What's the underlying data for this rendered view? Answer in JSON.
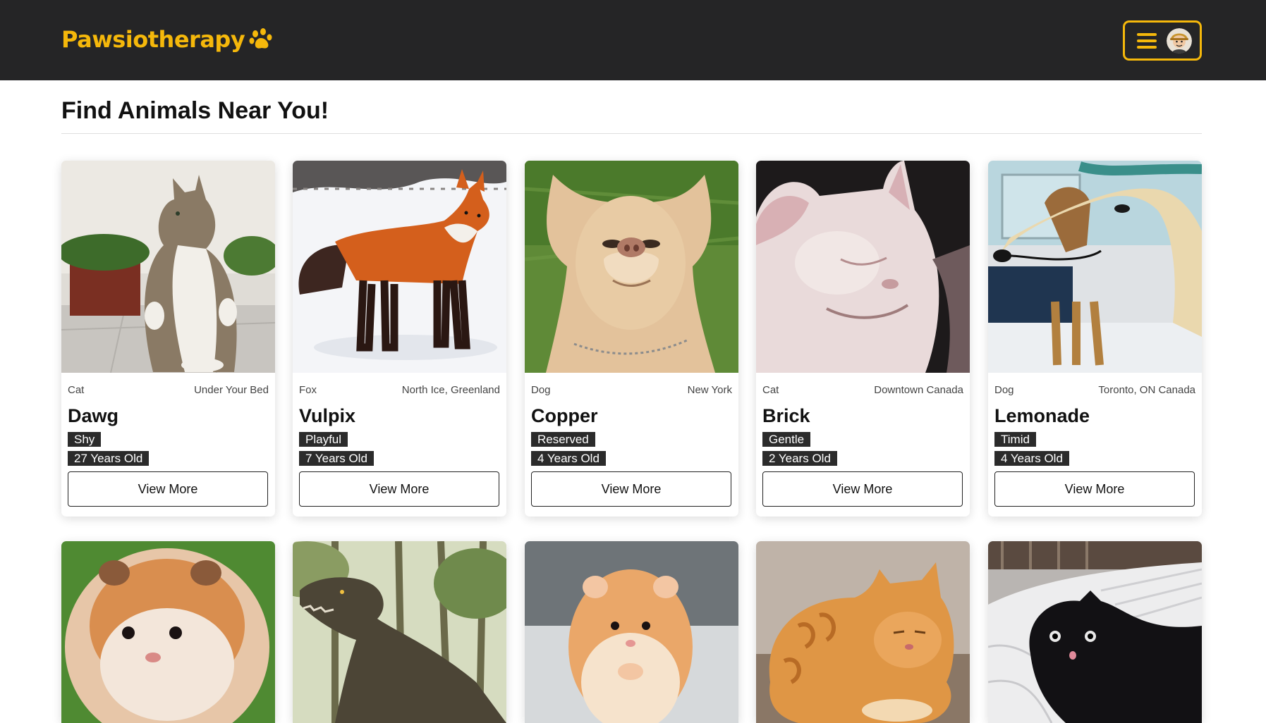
{
  "header": {
    "brand": "Pawsiotherapy",
    "brand_color": "#f5b80b",
    "menu_icon": "hamburger-icon",
    "avatar_icon": "user-avatar"
  },
  "main": {
    "title": "Find Animals Near You!"
  },
  "cards": [
    {
      "species": "Cat",
      "location": "Under Your Bed",
      "name": "Dawg",
      "trait": "Shy",
      "age": "27 Years Old",
      "button": "View More",
      "photo": "cat-standing"
    },
    {
      "species": "Fox",
      "location": "North Ice, Greenland",
      "name": "Vulpix",
      "trait": "Playful",
      "age": "7 Years Old",
      "button": "View More",
      "photo": "fox-in-snow"
    },
    {
      "species": "Dog",
      "location": "New York",
      "name": "Copper",
      "trait": "Reserved",
      "age": "4 Years Old",
      "button": "View More",
      "photo": "chihuahua-on-grass"
    },
    {
      "species": "Cat",
      "location": "Downtown Canada",
      "name": "Brick",
      "trait": "Gentle",
      "age": "2 Years Old",
      "button": "View More",
      "photo": "white-cat-closeup"
    },
    {
      "species": "Dog",
      "location": "Toronto, ON Canada",
      "name": "Lemonade",
      "trait": "Timid",
      "age": "4 Years Old",
      "button": "View More",
      "photo": "borzoi-dog"
    }
  ],
  "row2_photos": [
    "hamster-on-grass",
    "dinosaur-in-forest",
    "hamster-standing",
    "orange-cat-lying",
    "black-cat-in-bed"
  ]
}
